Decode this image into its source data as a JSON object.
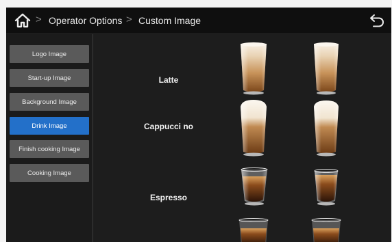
{
  "topbar": {
    "breadcrumb": [
      "Operator Options",
      "Custom Image"
    ],
    "separator": ">"
  },
  "sidebar": {
    "items": [
      {
        "label": "Logo Image",
        "active": false
      },
      {
        "label": "Start-up Image",
        "active": false
      },
      {
        "label": "Background Image",
        "active": false
      },
      {
        "label": "Drink Image",
        "active": true
      },
      {
        "label": "Finish cooking Image",
        "active": false
      },
      {
        "label": "Cooking Image",
        "active": false
      }
    ]
  },
  "drinks": [
    {
      "name": "Latte",
      "image": "latte-glass"
    },
    {
      "name": "Cappucci no",
      "image": "cappuccino-glass"
    },
    {
      "name": "Espresso",
      "image": "espresso-glass"
    },
    {
      "name": "",
      "image": "coffee-glass"
    }
  ],
  "colors": {
    "accent": "#2370c9",
    "menu_button": "#5a5a5a",
    "background": "#1d1d1d"
  }
}
